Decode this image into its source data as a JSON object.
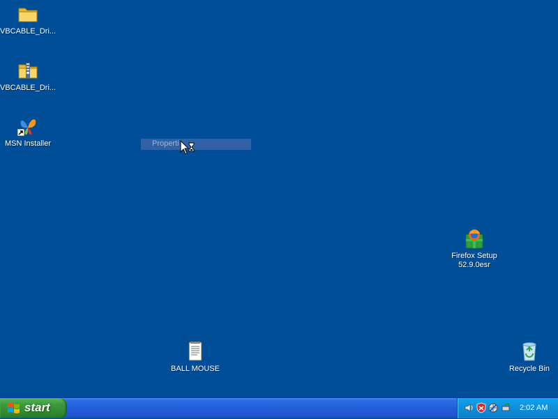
{
  "desktop": {
    "icons": [
      {
        "label": "VBCABLE_Dri...",
        "icon": "folder-icon"
      },
      {
        "label": "VBCABLE_Dri...",
        "icon": "zip-folder-icon"
      },
      {
        "label": "MSN Installer",
        "icon": "msn-butterfly-icon"
      },
      {
        "label": "Firefox Setup",
        "label2": "52.9.0esr",
        "icon": "firefox-setup-icon"
      },
      {
        "label": "BALL MOUSE",
        "icon": "text-document-icon"
      },
      {
        "label": "Recycle Bin",
        "icon": "recycle-bin-icon"
      }
    ],
    "background_color": "#004e98"
  },
  "ghost_menu": {
    "item": "Properti"
  },
  "taskbar": {
    "start_label": "start",
    "tray_icons": [
      "speaker-icon",
      "security-shield-icon",
      "network-icon",
      "safely-remove-icon"
    ],
    "clock": "2:02 AM"
  }
}
